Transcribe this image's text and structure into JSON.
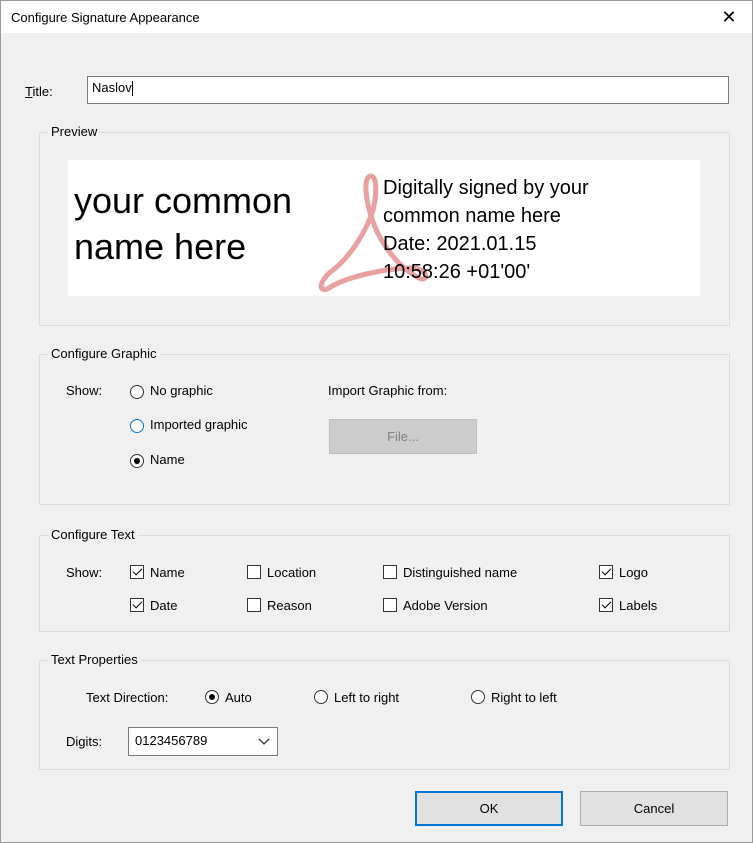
{
  "window": {
    "title": "Configure Signature Appearance",
    "close_glyph": "✕"
  },
  "title_field": {
    "label": "Title:",
    "value": "Naslov"
  },
  "preview": {
    "group_label": "Preview",
    "name_line1": "your common",
    "name_line2": "name here",
    "details_line1": "Digitally signed by your",
    "details_line2": "common name here",
    "details_line3": "Date: 2021.01.15",
    "details_line4": "10:58:26 +01'00'"
  },
  "graphic": {
    "group_label": "Configure Graphic",
    "show_label": "Show:",
    "options": [
      {
        "label": "No graphic",
        "selected": false
      },
      {
        "label": "Imported graphic",
        "selected": false
      },
      {
        "label": "Name",
        "selected": true
      }
    ],
    "import_label": "Import Graphic from:",
    "file_button": "File..."
  },
  "text": {
    "group_label": "Configure Text",
    "show_label": "Show:",
    "checkboxes": [
      {
        "label": "Name",
        "checked": true
      },
      {
        "label": "Location",
        "checked": false
      },
      {
        "label": "Distinguished name",
        "checked": false
      },
      {
        "label": "Logo",
        "checked": true
      },
      {
        "label": "Date",
        "checked": true
      },
      {
        "label": "Reason",
        "checked": false
      },
      {
        "label": "Adobe Version",
        "checked": false
      },
      {
        "label": "Labels",
        "checked": true
      }
    ]
  },
  "properties": {
    "group_label": "Text Properties",
    "direction_label": "Text Direction:",
    "direction_options": [
      {
        "label": "Auto",
        "selected": true
      },
      {
        "label": "Left to right",
        "selected": false
      },
      {
        "label": "Right to left",
        "selected": false
      }
    ],
    "digits_label": "Digits:",
    "digits_value": "0123456789"
  },
  "buttons": {
    "ok": "OK",
    "cancel": "Cancel"
  },
  "colors": {
    "focus_blue": "#0078d7",
    "logo_red": "#e8a0a0"
  }
}
